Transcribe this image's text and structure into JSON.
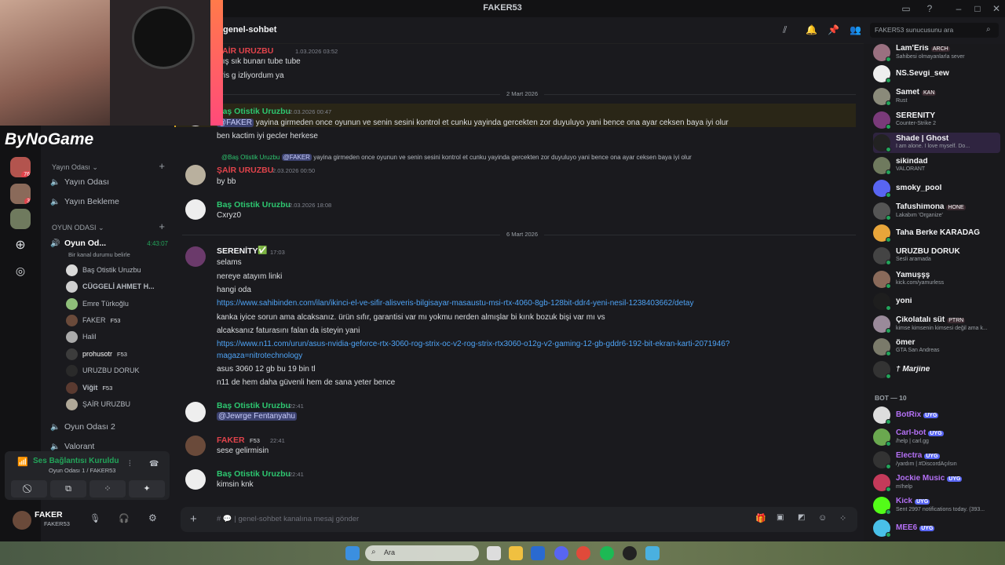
{
  "window": {
    "title": "FAKER53"
  },
  "stream_overlay": {
    "logo_text": "ByNoGame"
  },
  "sidebar": {
    "categories": [
      {
        "label": "Yayın Odası",
        "channels": [
          "Yayın Odası",
          "Yayın Bekleme"
        ]
      },
      {
        "label": "OYUN ODASI"
      }
    ],
    "active_voice": {
      "name": "Oyun Od...",
      "timer": "4:43:07",
      "status": "Bir kanal durumu belirle"
    },
    "voice_users": [
      {
        "name": "Baş Otistik Uruzbu",
        "tag": ""
      },
      {
        "name": "CÜGGELİ AHMET H...",
        "tag": ""
      },
      {
        "name": "Emre Türkoğlu",
        "tag": ""
      },
      {
        "name": "FAKER",
        "tag": "F53"
      },
      {
        "name": "Halil",
        "tag": ""
      },
      {
        "name": "prohusotr",
        "tag": "F53"
      },
      {
        "name": "URUZBU DORUK",
        "tag": ""
      },
      {
        "name": "Viğit",
        "tag": "F53"
      },
      {
        "name": "ŞAİR URUZBU",
        "tag": ""
      }
    ],
    "other_channels": [
      "Oyun Odası 2",
      "Valorant"
    ],
    "voice_status": {
      "title": "Ses Bağlantısı Kuruldu",
      "sub": "Oyun Odası 1 / FAKER53"
    },
    "user": {
      "name": "FAKER",
      "sub": "FAKER53"
    },
    "server_badges": [
      "76",
      "3"
    ]
  },
  "header": {
    "channel": "genel-sohbet",
    "search_placeholder": "FAKER53 sunucusunu ara"
  },
  "messages": {
    "m1": {
      "author": "ŞAİR URUZBU",
      "time": "1.03.2026 03:52",
      "lines": [
        "alış sık bunarı tube tube",
        "aris g izliyordum ya"
      ]
    },
    "divider1": "2 Mart 2026",
    "m2": {
      "author": "Baş Otistik Uruzbu",
      "time": "2.03.2026 00:47",
      "mention": "@FAKER",
      "line1": " yayina girmeden once oyunun ve senin sesini kontrol et cunku yayinda gercekten zor duyuluyo yani bence ona ayar ceksen baya iyi olur",
      "line2": "ben kactim iyi gecler herkese"
    },
    "m3": {
      "reply_author": "@Baş Otistik Uruzbu",
      "reply_mention": "@FAKER",
      "reply_text": " yayina girmeden once oyunun ve senin sesini kontrol et cunku yayinda gercekten zor duyuluyo yani bence ona ayar ceksen baya iyi olur",
      "author": "ŞAİR URUZBU",
      "time": "2.03.2026 00:50",
      "line": "by bb"
    },
    "m4": {
      "author": "Baş Otistik Uruzbu",
      "time": "2.03.2026 18:08",
      "line": "Cxryz0"
    },
    "divider2": "6 Mart 2026",
    "m5": {
      "author": "SERENİTY",
      "time": "17:03",
      "lines": [
        "selams",
        "nereye atayım linki",
        "hangi oda"
      ],
      "link1": "https://www.sahibinden.com/ilan/ikinci-el-ve-sifir-alisveris-bilgisayar-masaustu-msi-rtx-4060-8gb-128bit-ddr4-yeni-nesil-1238403662/detay",
      "lines2": [
        "kanka iyice sorun ama alcaksanız. ürün sıfır, garantisi var mı yokmu nerden almışlar bi kırık bozuk bişi var mı vs",
        "alcaksanız faturasını falan da isteyin yani"
      ],
      "link2a": "https://www.n11.com/urun/asus-nvidia-geforce-rtx-3060-rog-strix-oc-v2-rog-strix-rtx3060-o12g-v2-gaming-12-gb-gddr6-192-bit-ekran-karti-2071946?",
      "link2b": "magaza=nitrotechnology",
      "lines3": [
        "asus 3060 12 gb bu 19 bin tl",
        "n11 de hem daha güvenli hem de sana yeter bence"
      ]
    },
    "m6": {
      "author": "Baş Otistik Uruzbu",
      "time": "22:41",
      "mention": "@Jewrge Fentanyahu"
    },
    "m7": {
      "author": "FAKER",
      "tag": "F53",
      "time": "22:41",
      "line": "sese gelirmisin"
    },
    "m8": {
      "author": "Baş Otistik Uruzbu",
      "time": "22:41",
      "line": "kimsin knk"
    }
  },
  "input": {
    "placeholder": "| genel-sohbet kanalına mesaj gönder"
  },
  "members": [
    {
      "name": "Lam'Eris",
      "tag": "ARCH",
      "sub": "Sahibesi olmayanlarla sever"
    },
    {
      "name": "NS.Sevgi_sew",
      "tag": "",
      "sub": ""
    },
    {
      "name": "Samet",
      "tag": "KAN",
      "sub": "Rust"
    },
    {
      "name": "SERENİTY",
      "tag": "",
      "sub": "Counter-Strike 2"
    },
    {
      "name": "Shade | Ghost",
      "tag": "",
      "sub": "I am alone. I love myself. Do..."
    },
    {
      "name": "sikindad",
      "tag": "",
      "sub": "VALORANT"
    },
    {
      "name": "smoky_pool",
      "tag": "",
      "sub": ""
    },
    {
      "name": "Tafushimona",
      "tag": "HONE",
      "sub": "Lakabım 'Organize'"
    },
    {
      "name": "Taha Berke KARADAĞ",
      "tag": "",
      "sub": ""
    },
    {
      "name": "URUZBU DORUK",
      "tag": "",
      "sub": "Sesli aramada"
    },
    {
      "name": "Yamuşşş",
      "tag": "",
      "sub": "kick.com/yamurless"
    },
    {
      "name": "yoni",
      "tag": "",
      "sub": ""
    },
    {
      "name": "Çikolatalı süt",
      "tag": "PTRN",
      "sub": "kimse kimsenin kimsesi değil ama k..."
    },
    {
      "name": "ömer",
      "tag": "",
      "sub": "GTA San Andreas"
    },
    {
      "name": "† Marjine",
      "tag": "",
      "sub": ""
    }
  ],
  "bots_header": "BOT — 10",
  "bots": [
    {
      "name": "BotRix",
      "sub": ""
    },
    {
      "name": "Carl-bot",
      "sub": "/help | carl.gg"
    },
    {
      "name": "Electra",
      "sub": "/yardım | #DiscordAçılsın"
    },
    {
      "name": "Jockie Music",
      "sub": "m!help"
    },
    {
      "name": "Kick",
      "sub": "Sent 2997 notifications today. (393..."
    },
    {
      "name": "MEE6",
      "sub": ""
    }
  ],
  "bot_badge": "UYG",
  "taskbar": {
    "search_placeholder": "Ara"
  },
  "colors": {
    "accent": "#5865f2",
    "green_name": "#2dc770",
    "red_name": "#e0434b",
    "link": "#4ea3f5"
  }
}
